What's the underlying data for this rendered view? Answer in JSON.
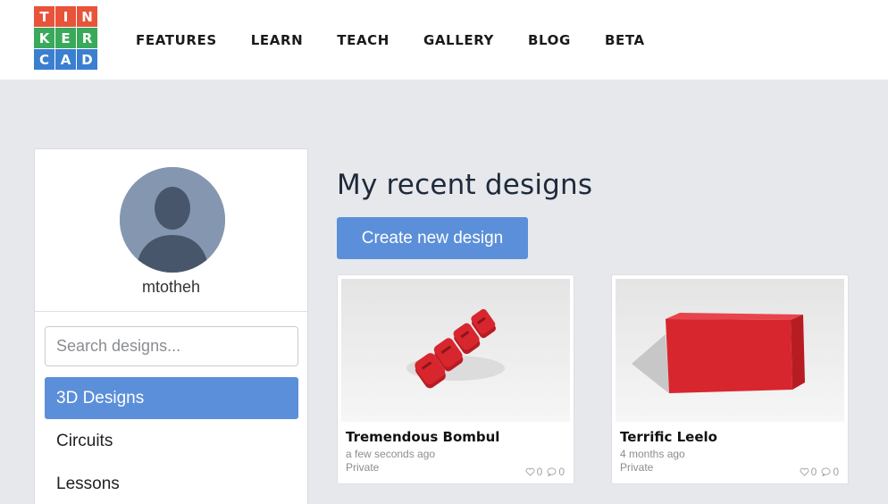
{
  "logo": {
    "letters": [
      "T",
      "I",
      "N",
      "K",
      "E",
      "R",
      "C",
      "A",
      "D"
    ],
    "colors": [
      "#e8533a",
      "#e8533a",
      "#e8533a",
      "#3aa95b",
      "#3aa95b",
      "#3aa95b",
      "#3b7fd0",
      "#3b7fd0",
      "#3b7fd0"
    ]
  },
  "nav": {
    "items": [
      "FEATURES",
      "LEARN",
      "TEACH",
      "GALLERY",
      "BLOG",
      "BETA"
    ]
  },
  "sidebar": {
    "username": "mtotheh",
    "search_placeholder": "Search designs...",
    "items": [
      {
        "label": "3D Designs",
        "active": true
      },
      {
        "label": "Circuits",
        "active": false
      },
      {
        "label": "Lessons",
        "active": false
      }
    ]
  },
  "main": {
    "title": "My recent designs",
    "create_button": "Create new design",
    "designs": [
      {
        "title": "Tremendous Bombul",
        "time": "a few seconds ago",
        "privacy": "Private",
        "likes": "0",
        "comments": "0",
        "thumb_icon": "red-3d-text-model"
      },
      {
        "title": "Terrific Leelo",
        "time": "4 months ago",
        "privacy": "Private",
        "likes": "0",
        "comments": "0",
        "thumb_icon": "red-box-model"
      }
    ]
  },
  "colors": {
    "accent": "#5b8fd9",
    "page_background": "#e6e8ec",
    "model_red": "#d8262e"
  }
}
